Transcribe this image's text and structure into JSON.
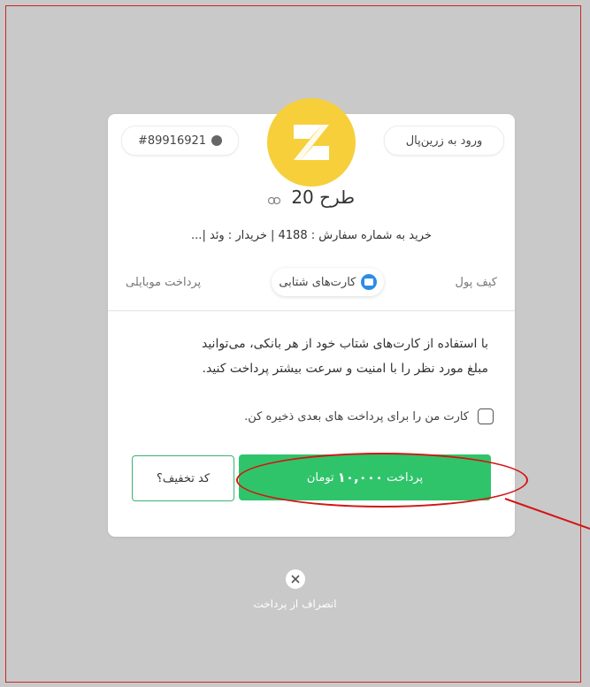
{
  "header": {
    "login_label": "ورود به زرین‌پال",
    "order_id": "#89916921",
    "title": "طرح 20",
    "description": "خرید به شماره سفارش : 4188 | خریدار : وئد |..."
  },
  "tabs": [
    {
      "label": "کیف پول",
      "active": false
    },
    {
      "label": "کارت‌های شتابی",
      "active": true
    },
    {
      "label": "پرداخت موبایلی",
      "active": false
    }
  ],
  "info": {
    "line1": "با استفاده از کارت‌های شتاب خود از هر بانکی، می‌توانید",
    "line2": "مبلغ مورد نظر را با امنیت و سرعت بیشتر پرداخت کنید."
  },
  "save_card": {
    "label": "کارت من را برای پرداخت های بعدی ذخیره کن.",
    "checked": false
  },
  "pay_button": {
    "prefix": "پرداخت",
    "amount": "۱۰,۰۰۰",
    "suffix": "تومان",
    "color": "#2fc46a"
  },
  "discount_button": {
    "label": "کد تخفیف؟"
  },
  "cancel": {
    "label": "انصراف از پرداخت"
  },
  "colors": {
    "logo": "#f6cf3b",
    "annotation": "#d31515",
    "card_icon": "#2d8be8"
  }
}
